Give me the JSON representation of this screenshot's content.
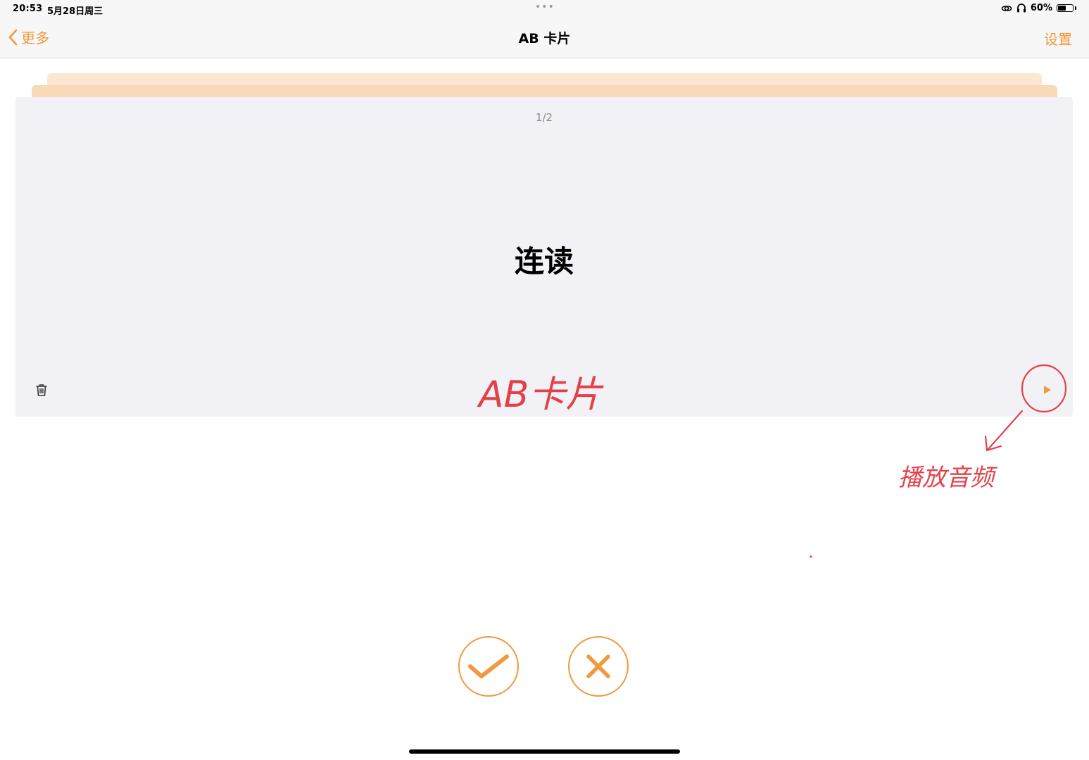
{
  "status_bar": {
    "time": "20:53",
    "date": "5月28日周三",
    "dots": "•••",
    "battery_percent": "60%",
    "battery_level": 0.6
  },
  "nav": {
    "back_label": "更多",
    "title": "AB 卡片",
    "settings_label": "设置"
  },
  "card": {
    "counter": "1/2",
    "word": "连读"
  },
  "annotations": {
    "card_label": "AB卡片",
    "play_label": "播放音频"
  },
  "colors": {
    "accent": "#f09a3e",
    "annotation": "#e3414a",
    "card_bg": "#f2f2f6"
  },
  "icons": [
    "chevron-left-icon",
    "trash-icon",
    "play-icon",
    "checkmark-icon",
    "close-icon",
    "headphones-icon",
    "link-icon",
    "battery-icon"
  ]
}
